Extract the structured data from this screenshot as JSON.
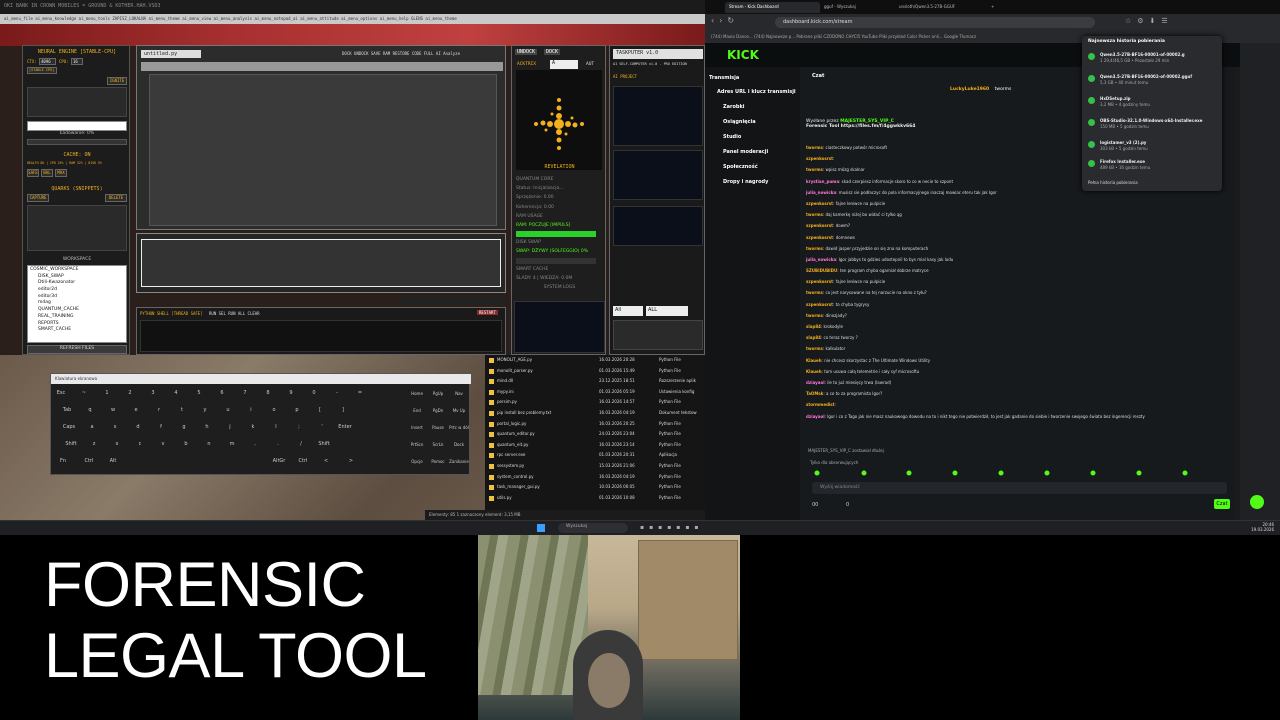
{
  "left_window": {
    "title": "OKI BANK IN CROWN MOBILES = GROUND & KOTHER.HAH.VSD3",
    "menu": "ai_menu_file   ai_menu_knowledge   ai_menu_tools   ZAPISZ_LOKALNA   ai_menu_theme   ai_menu_view   ai_menu_analysis   ai_menu_notepad_ai   ai_menu_attitude   ai_menu_options   ai_menu_help   GLENS   ai_menu_theme"
  },
  "neural": {
    "title": "NEURAL ENGINE [STABLE-CPU]",
    "ctx_label": "CTX:",
    "ctx_value": "4096",
    "cpu_label": "CPU:",
    "cpu_value": "16",
    "stable_label": "[STABLE CPU]",
    "ignite": "IGNITE",
    "loading": "Ładowanie: 0%",
    "cache": "CACHE: ON",
    "health": "HEALTH OK | CPU 24% | RAM 32% | DISK 5%",
    "safe": "SAFE",
    "bal": "BAL",
    "max": "MAX",
    "quarks": "QUARKS (SNIPPETS)",
    "capture": "CAPTURE",
    "delete": "DELETE",
    "workspace": "WORKSPACE",
    "tree": [
      "COSMIC_WORKSPACE",
      "DISK_SWAP",
      "Dtili-Kwazonator",
      "editor2d",
      "editor3d",
      "mdag",
      "QUANTUM_CACHE",
      "REAL_TRAINING",
      "REPORTS",
      "SMART_CACHE"
    ],
    "refresh": "REFRESH FILES"
  },
  "editor": {
    "tab": "untitled.py",
    "toolbar": "DOCK   UNDOCK   SAVE   RAM   RESTORE   CODE FULL   AI Analyze",
    "shell_label": "PYTHON SHELL [THREAD SAFE]",
    "shell_buttons": "RUN   SEL   RUN ALL   CLEAR",
    "restart": "RESTART"
  },
  "qcore": {
    "undock": "UNDOCK",
    "dock": "DOCK",
    "field_label": "ACKTRIX",
    "field_value": "A",
    "aut": "AUT",
    "revelation": "REVELATION",
    "quantum_core": "QUANTUM CORE",
    "status": "Status: Inicjalizacja...",
    "sprzezenie": "Sprzężenie: 0.00",
    "koherencja": "Koherencja: 0.00",
    "ram_usage": "RAM USAGE",
    "ram_pool": "RAM: POCZUJE [IMPULS]",
    "disk_swap": "DISK SWAP",
    "swap_status": "SWAP: DŻYWY (SOLFEGGIO) 0%",
    "smart_cache": "SMART CACHE",
    "sladow": "ŚLADY: 4 | WIEDZA: 0.0M",
    "system_logs": "SYSTEM LOGS"
  },
  "taskputer": {
    "title": "TASKPUTER v1.0",
    "subtitle": "AI SELF-COMPUTER v1.0 - PRO EDITION",
    "ai_project": "AI PROJECT",
    "filter_all": "All",
    "filter_all2": "ALL"
  },
  "files": {
    "rows": [
      {
        "name": "MONOLIT_AGE.py",
        "date": "16.03.2026 20:28",
        "type": "Python File"
      },
      {
        "name": "monolit_parser.py",
        "date": "01.03.2026 15:49",
        "type": "Python File"
      },
      {
        "name": "mind.dll",
        "date": "23.12.2025 18:51",
        "type": "Rozszerzenie aplik"
      },
      {
        "name": "mypy.ini",
        "date": "01.03.2026 05:19",
        "type": "Ustawienia konfig"
      },
      {
        "name": "persim.py",
        "date": "16.03.2026 14:57",
        "type": "Python File"
      },
      {
        "name": "pip install bez problemy.txt",
        "date": "16.03.2026 04:19",
        "type": "Dokument tekstow"
      },
      {
        "name": "portal_logic.py",
        "date": "16.03.2026 20:25",
        "type": "Python File"
      },
      {
        "name": "quantum_editor.py",
        "date": "24.03.2026 23:04",
        "type": "Python File"
      },
      {
        "name": "quantum_eit.py",
        "date": "16.03.2026 23:14",
        "type": "Python File"
      },
      {
        "name": "rpc server.exe",
        "date": "01.03.2026 20:31",
        "type": "Aplikacja"
      },
      {
        "name": "sessystem.py",
        "date": "15.03.2026 21:06",
        "type": "Python File"
      },
      {
        "name": "system_control.py",
        "date": "16.03.2026 04:19",
        "type": "Python File"
      },
      {
        "name": "task_manager_gui.py",
        "date": "10.03.2026 06:05",
        "type": "Python File"
      },
      {
        "name": "utils.py",
        "date": "01.03.2026 10:08",
        "type": "Python File"
      }
    ],
    "status": "Elementy: 85   1 zaznaczony element: 3,15 MB"
  },
  "keyboard": {
    "title": "Klawiatura ekranowa",
    "row1": [
      "Esc",
      "~",
      "1",
      "2",
      "3",
      "4",
      "5",
      "6",
      "7",
      "8",
      "9",
      "0",
      "-",
      "="
    ],
    "row2": [
      "Tab",
      "q",
      "w",
      "e",
      "r",
      "t",
      "y",
      "u",
      "i",
      "o",
      "p",
      "[",
      "]"
    ],
    "row3": [
      "Caps",
      "a",
      "s",
      "d",
      "f",
      "g",
      "h",
      "j",
      "k",
      "l",
      ";",
      "'",
      "Enter"
    ],
    "row4": [
      "Shift",
      "z",
      "x",
      "c",
      "v",
      "b",
      "n",
      "m",
      ",",
      ".",
      "/",
      "Shift"
    ],
    "row5": [
      "Fn",
      "Ctrl",
      "Alt",
      "AltGr",
      "Ctrl",
      "<",
      ">"
    ],
    "side": [
      "Home",
      "PgUp",
      "Nav",
      "End",
      "PgDn",
      "Mv Up",
      "Insert",
      "Pause",
      "Prtc w dół",
      "PrtScn",
      "ScrLk",
      "Dock",
      "Opcje",
      "Pomoc",
      "Zanikanie"
    ]
  },
  "browser": {
    "tabs": [
      "Stream - Kick Dashboard",
      "gguf - Wyszukaj",
      "unsloth/Qwen3.5-27B-GGUF"
    ],
    "url": "dashboard.kick.com/stream",
    "bookmarks": "(744) Maxia Dance...   (744) Najnowsze p...   Pobrane pliki   CZODONO   CHYCI5   YouTube   Pliki   przykład   Color Picker onli...   Google Tłumacz",
    "download_header": "Najnowsza historia pobierania",
    "downloads": [
      {
        "name": "Qwen3.5-27B-BF16-00001-of-00002.g",
        "status": "1 29,4/46,5 GB • Pozostało 29 min"
      },
      {
        "name": "Qwen3.5-27B-BF16-00002-of-00002.gguf",
        "status": "5,3 GB • 40 minut temu"
      },
      {
        "name": "HxDSetup.zip",
        "status": "3,2 MB • 4 godziny temu"
      },
      {
        "name": "OBS-Studio-32.1.0-Windows-x64-Installer.exe",
        "status": "150 MB • 5 godzin temu"
      },
      {
        "name": "logistamer_v3 (2).py",
        "status": "303 kB • 5 godzin temu"
      },
      {
        "name": "Firefox Installer.exe",
        "status": "489 kB • 16 godzin temu"
      }
    ],
    "download_history": "Pełna historia pobierania"
  },
  "kick": {
    "logo": "KICK",
    "nav": [
      "Transmisja",
      "Adres URL i klucz transmisji",
      "Zarobki",
      "Osiągnięcia",
      "Studio",
      "Panel moderacji",
      "Społeczność",
      "Dropy i nagrody"
    ],
    "chat_title": "Czat",
    "sub_user": "LuckyLuke1960",
    "sub_info": "tworms",
    "pinned_label": "Wysłane przez",
    "pinned_user": "MAJESTER_SYS_VIP_C",
    "pinned_text": "Forensic Tool https://files.fm/f/4ggwkkv664",
    "messages": [
      {
        "user": "tworms",
        "text": "ciasteczkowy potwór microsoft"
      },
      {
        "user": "szpenkosrst",
        "text": ""
      },
      {
        "user": "tworms",
        "text": "wpisz mózg skalnar"
      },
      {
        "user": "krystian_puma",
        "text": "skad czerpiesz informacje skoro to co w necie to szpont"
      },
      {
        "user": "julia_nowicka",
        "text": "musisz sie podłaczyc do pola informacyjnego inaczaj mowiac eteru tak jak Igor"
      },
      {
        "user": "szpenkosrst",
        "text": "fajne leniwce na pulpicie"
      },
      {
        "user": "tworms",
        "text": "daj kamerkę niżej bo widać ci tylko ąg"
      },
      {
        "user": "szpenkosrst",
        "text": "dowm?"
      },
      {
        "user": "szpenkosrst",
        "text": "domnews"
      },
      {
        "user": "tworms",
        "text": "dawid jasper przyjedzie on się zna na komputerach"
      },
      {
        "user": "julia_nowicka",
        "text": "Igor jabbys to gdzies udostepnil to bys mial kasy jak lodu"
      },
      {
        "user": "SZUBIDUBIDU",
        "text": "ten program chyba ogarniał dobrze matryce"
      },
      {
        "user": "szpenkosrst",
        "text": "fajne leniwce na pulpicie"
      },
      {
        "user": "tworms",
        "text": "co jest narysowane na tej narzucie na okno z tyłu?"
      },
      {
        "user": "szpenkosrst",
        "text": "to chyba tygrysy"
      },
      {
        "user": "tworms",
        "text": "dinozjady?"
      },
      {
        "user": "slap84",
        "text": "krokodyle"
      },
      {
        "user": "slap84",
        "text": "co teraz tworzy ?"
      },
      {
        "user": "tworms",
        "text": "kalkulator"
      },
      {
        "user": "Klaueh",
        "text": "nie chcesz skorzystac z The Ultimate Windows Utility"
      },
      {
        "user": "Klaueh",
        "text": "tam usuwa całą telemetrie i cały syf microsoftu"
      },
      {
        "user": "dziayaol",
        "text": "ile to już miesięcy trwa (lawrad)"
      },
      {
        "user": "TaOMsk",
        "text": "a co to za programista Igor?"
      },
      {
        "user": "stormmedist",
        "text": ""
      },
      {
        "user": "dziayaol",
        "text": "Igor i co z Tago jak nie masz naukowego dowodu na to i nikt tego nie potwierdził, to jest jak gadanie do siebie i tworzenie swojego świata bez ingerencji reszty"
      }
    ],
    "reply_to": "MAJESTER_SYS_VIP_C zostawiał dłużej",
    "followers_only": "Tylko dla obserwujących",
    "input_placeholder": "Wyślij wiadomość",
    "send": "Czat",
    "count_a": "00",
    "count_b": "0"
  },
  "taskbar": {
    "search": "Wyszukaj",
    "time": "20:46",
    "date": "19.03.2026"
  },
  "overlay": {
    "line1": "FORENSIC",
    "line2": "LEGAL TOOL"
  },
  "colors": {
    "kick_green": "#53fc18",
    "neural_accent": "#f2b01e",
    "terminal_bg": "#0b0f1a"
  }
}
